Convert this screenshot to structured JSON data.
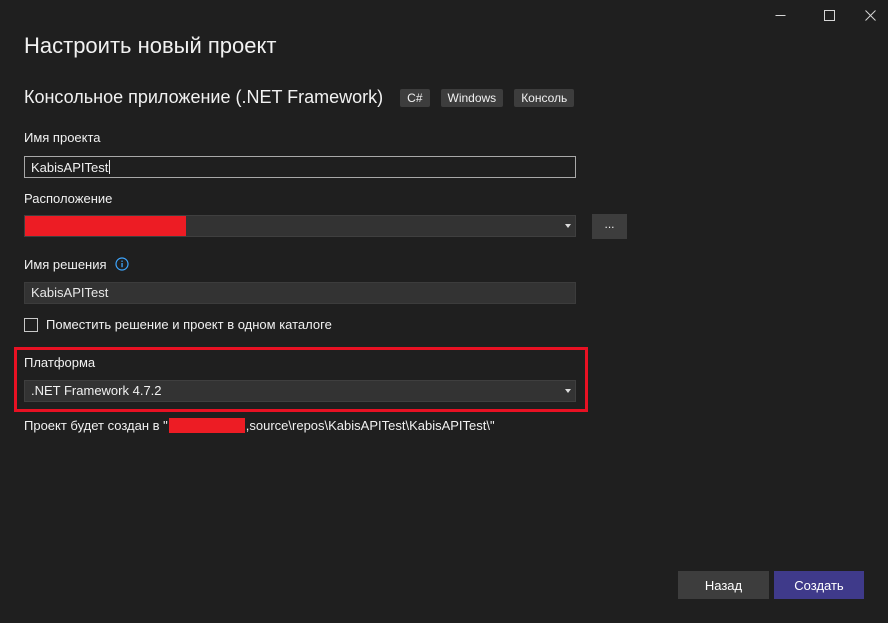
{
  "window": {
    "controls": {
      "minimize_icon": "minimize-icon",
      "maximize_icon": "maximize-icon",
      "close_icon": "close-icon"
    }
  },
  "title": "Настроить новый проект",
  "template": {
    "name": "Консольное приложение (.NET Framework)",
    "tags": [
      "C#",
      "Windows",
      "Консоль"
    ]
  },
  "project_name": {
    "label": "Имя проекта",
    "value": "KabisAPITest"
  },
  "location": {
    "label": "Расположение",
    "value": "",
    "browse_label": "..."
  },
  "solution_name": {
    "label": "Имя решения",
    "info_icon": "info-icon",
    "value": "KabisAPITest"
  },
  "same_folder": {
    "label": "Поместить решение и проект в одном каталоге",
    "checked": false
  },
  "platform": {
    "label": "Платформа",
    "value": ".NET Framework 4.7.2"
  },
  "path_info": {
    "prefix": "Проект будет создан в \"",
    "suffix": ",source\\repos\\KabisAPITest\\KabisAPITest\\\""
  },
  "buttons": {
    "back": "Назад",
    "create": "Создать"
  },
  "colors": {
    "background": "#1f1f1f",
    "accent": "#3f3a8a",
    "highlight": "#e81123",
    "redaction": "#ed1c24"
  }
}
